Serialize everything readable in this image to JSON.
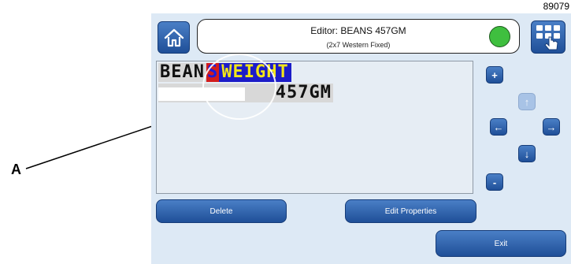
{
  "figure_number": "89079",
  "callout": {
    "letter": "A"
  },
  "header": {
    "home_icon": "house-icon",
    "title": "Editor: BEANS 457GM",
    "subtitle": "(2x7 Western Fixed)",
    "status_color": "#3fbf3f",
    "menu_icon": "grid-menu-hand-icon"
  },
  "editor": {
    "line1": {
      "plain": "BEAN",
      "cursor": "S",
      "selected": "WEIGHT"
    },
    "line2": "457GM"
  },
  "controls": {
    "add": "+",
    "remove": "-",
    "up": "↑",
    "down": "↓",
    "left": "←",
    "right": "→"
  },
  "buttons": {
    "delete": "Delete",
    "edit_properties": "Edit Properties",
    "exit": "Exit"
  },
  "colors": {
    "accent": "#2a5fa8",
    "panel": "#dde9f5",
    "selected_bg": "#1c1cc8",
    "selected_text": "#f2e51a",
    "cursor_bg": "#d21c1c"
  }
}
